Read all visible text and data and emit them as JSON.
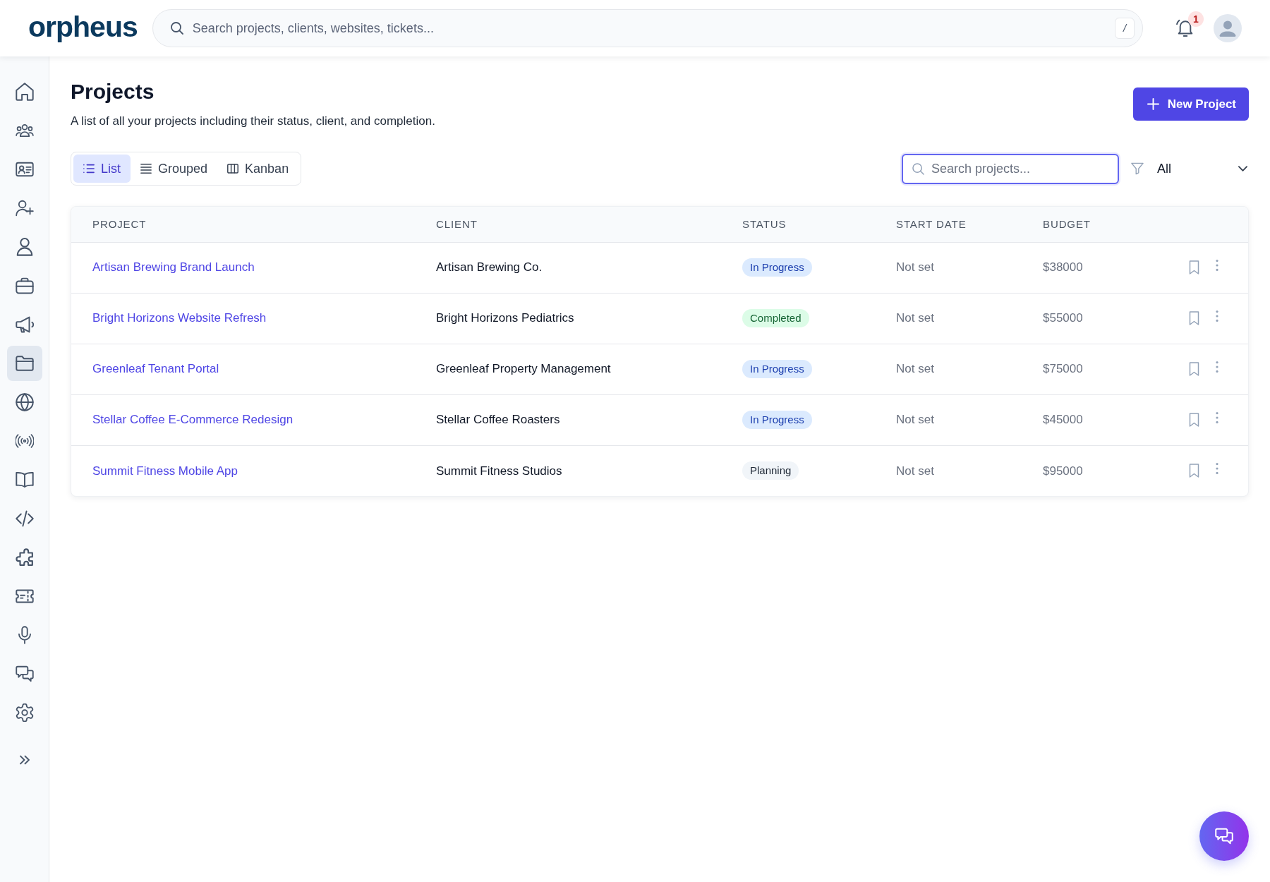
{
  "header": {
    "logo": "orpheus",
    "search": {
      "placeholder": "Search projects, clients, websites, tickets...",
      "shortcut": "/"
    },
    "notification_count": "1"
  },
  "sidebar": {
    "items": [
      {
        "selected": false
      },
      {
        "selected": false
      },
      {
        "selected": false
      },
      {
        "selected": false
      },
      {
        "selected": false
      },
      {
        "selected": false
      },
      {
        "selected": false
      },
      {
        "selected": true
      },
      {
        "selected": false
      },
      {
        "selected": false
      },
      {
        "selected": false
      },
      {
        "selected": false
      },
      {
        "selected": false
      },
      {
        "selected": false
      },
      {
        "selected": false
      },
      {
        "selected": false
      },
      {
        "selected": false
      }
    ]
  },
  "page": {
    "title": "Projects",
    "subtitle": "A list of all your projects including their status, client, and completion.",
    "new_button": "New Project"
  },
  "view_tabs": [
    {
      "label": "List",
      "kind": "list",
      "selected": true
    },
    {
      "label": "Grouped",
      "kind": "grouped",
      "selected": false
    },
    {
      "label": "Kanban",
      "kind": "kanban",
      "selected": false
    }
  ],
  "project_search": {
    "placeholder": "Search projects...",
    "focused": true
  },
  "status_filter": {
    "value": "All"
  },
  "table": {
    "columns": [
      "PROJECT",
      "CLIENT",
      "STATUS",
      "START DATE",
      "BUDGET"
    ],
    "rows": [
      {
        "project": "Artisan Brewing Brand Launch",
        "client": "Artisan Brewing Co.",
        "status": {
          "label": "In Progress",
          "kind": "progress"
        },
        "start_date": "Not set",
        "budget": "$38000"
      },
      {
        "project": "Bright Horizons Website Refresh",
        "client": "Bright Horizons Pediatrics",
        "status": {
          "label": "Completed",
          "kind": "completed"
        },
        "start_date": "Not set",
        "budget": "$55000"
      },
      {
        "project": "Greenleaf Tenant Portal",
        "client": "Greenleaf Property Management",
        "status": {
          "label": "In Progress",
          "kind": "progress"
        },
        "start_date": "Not set",
        "budget": "$75000"
      },
      {
        "project": "Stellar Coffee E-Commerce Redesign",
        "client": "Stellar Coffee Roasters",
        "status": {
          "label": "In Progress",
          "kind": "progress"
        },
        "start_date": "Not set",
        "budget": "$45000"
      },
      {
        "project": "Summit Fitness Mobile App",
        "client": "Summit Fitness Studios",
        "status": {
          "label": "Planning",
          "kind": "planning"
        },
        "start_date": "Not set",
        "budget": "$95000"
      }
    ]
  }
}
